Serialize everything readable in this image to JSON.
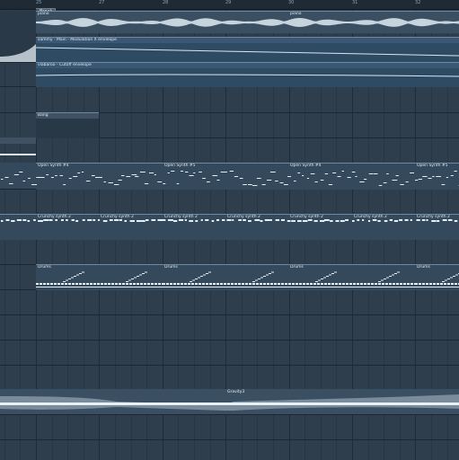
{
  "ruler": {
    "bars": [
      "25",
      "27",
      "28",
      "29",
      "30",
      "31",
      "32"
    ]
  },
  "marker": {
    "label": "Break"
  },
  "clips": {
    "piano_a": "piano",
    "piano_b": "piano",
    "modulation": "sammy - Main - Modulation X envelope",
    "cutoff": "vlabaroo - Cutoff envelope",
    "bang": "Bang",
    "open_synth": [
      "Open Synth #4",
      "Open Synth #5",
      "Open Synth #4",
      "Open Synth #5"
    ],
    "crunchy": [
      "Crunchy synth 2",
      "Crunchy synth 2",
      "Crunchy synth 2",
      "Crunchy synth 2",
      "Crunchy synth 2",
      "Crunchy synth 2",
      "Crunchy synth 2"
    ],
    "drums": [
      "Drums",
      "Drums",
      "Drums",
      "Drums"
    ],
    "gravity": "Gravity3"
  },
  "colors": {
    "ruler_bg": "#1f2a35",
    "grid_bg": "#2e3e4d",
    "clip_bg": "#3f5569",
    "automation_bg": "#2f4a63",
    "note_color": "#e6eef5"
  }
}
